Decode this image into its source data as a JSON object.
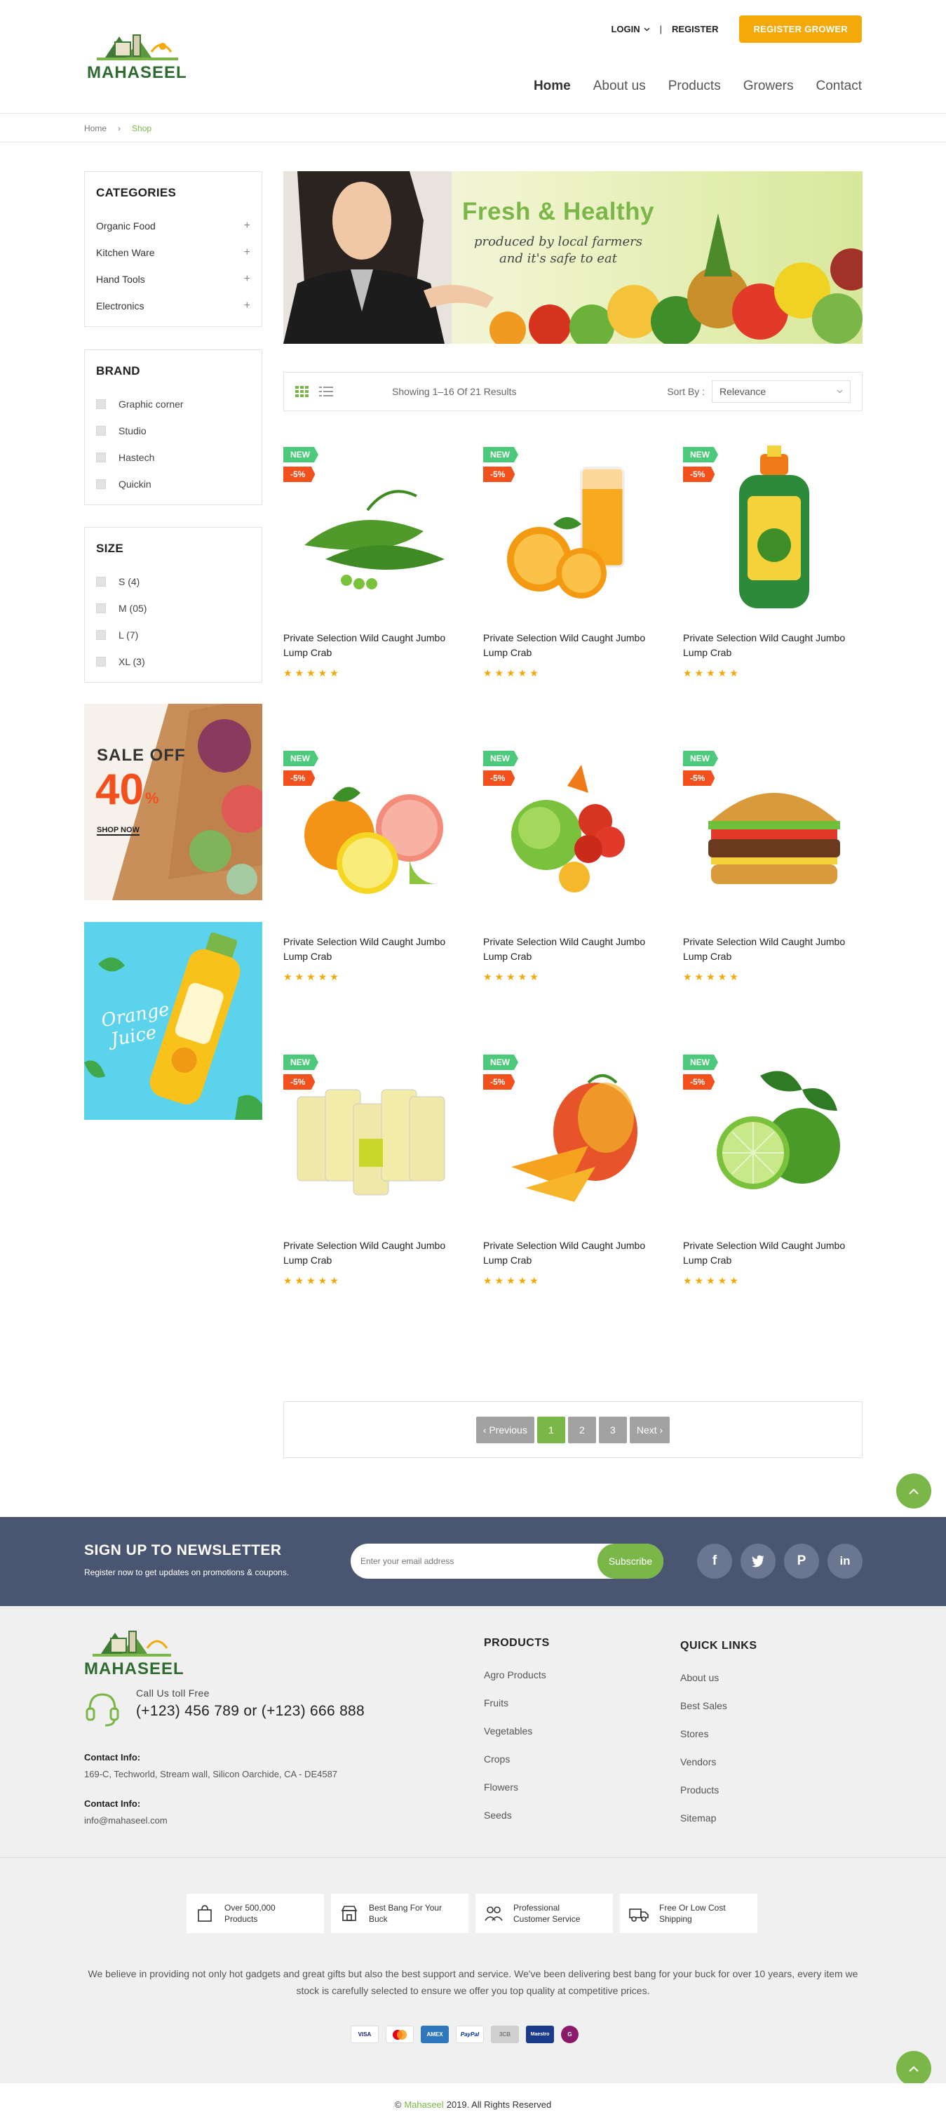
{
  "header": {
    "brand": "MAHASEEL",
    "login_label": "LOGIN",
    "separator": "|",
    "register_label": "REGISTER",
    "register_grower_label": "REGISTER GROWER",
    "nav": [
      {
        "label": "Home",
        "active": true
      },
      {
        "label": "About us"
      },
      {
        "label": "Products"
      },
      {
        "label": "Growers"
      },
      {
        "label": "Contact"
      }
    ]
  },
  "breadcrumb": {
    "home": "Home",
    "sep": "›",
    "current": "Shop"
  },
  "sidebar": {
    "categories_title": "CATEGORIES",
    "categories": [
      "Organic Food",
      "Kitchen Ware",
      "Hand Tools",
      "Electronics"
    ],
    "plus": "+",
    "brand_title": "BRAND",
    "brands": [
      "Graphic corner",
      "Studio",
      "Hastech",
      "Quickin"
    ],
    "size_title": "SIZE",
    "sizes": [
      "S (4)",
      "M (05)",
      "L (7)",
      "XL (3)"
    ],
    "promo_sale": {
      "line1": "SALE OFF",
      "percent": "40",
      "pct_sign": "%",
      "cta": "SHOP NOW"
    },
    "promo_juice": {
      "line1": "Orange",
      "line2": "Juice"
    }
  },
  "hero": {
    "title": "Fresh & Healthy",
    "line1": "produced by local farmers",
    "line2": "and it's safe to eat"
  },
  "toolbar": {
    "showing": "Showing 1–16 Of 21 Results",
    "sort_label": "Sort By :",
    "sort_value": "Relevance"
  },
  "products": {
    "badge_new": "NEW",
    "badge_sale": "-5%",
    "stars": "★★★★★",
    "items": [
      {
        "name": "Private Selection Wild Caught Jumbo Lump Crab",
        "image": "peas"
      },
      {
        "name": "Private Selection Wild Caught Jumbo Lump Crab",
        "image": "orange-juice"
      },
      {
        "name": "Private Selection Wild Caught Jumbo Lump Crab",
        "image": "fertilizer-bottle"
      },
      {
        "name": "Private Selection Wild Caught Jumbo Lump Crab",
        "image": "citrus"
      },
      {
        "name": "Private Selection Wild Caught Jumbo Lump Crab",
        "image": "vegetables"
      },
      {
        "name": "Private Selection Wild Caught Jumbo Lump Crab",
        "image": "burger"
      },
      {
        "name": "Private Selection Wild Caught Jumbo Lump Crab",
        "image": "seed-packs"
      },
      {
        "name": "Private Selection Wild Caught Jumbo Lump Crab",
        "image": "mango"
      },
      {
        "name": "Private Selection Wild Caught Jumbo Lump Crab",
        "image": "lime"
      }
    ]
  },
  "pagination": {
    "prev": "‹ Previous",
    "pages": [
      "1",
      "2",
      "3"
    ],
    "current": 1,
    "next": "Next ›"
  },
  "newsletter": {
    "title": "SIGN UP TO NEWSLETTER",
    "subtitle": "Register now to get updates on promotions & coupons.",
    "placeholder": "Enter your email address",
    "button": "Subscribe",
    "socials": [
      {
        "icon": "facebook-icon",
        "glyph": "f"
      },
      {
        "icon": "twitter-icon",
        "glyph": "t"
      },
      {
        "icon": "pinterest-icon",
        "glyph": "P"
      },
      {
        "icon": "linkedin-icon",
        "glyph": "in"
      }
    ]
  },
  "footer": {
    "brand": "MAHASEEL",
    "call_label": "Call Us toll Free",
    "phones": "(+123) 456 789 or (+123) 666 888",
    "contact1_label": "Contact Info:",
    "contact1_value": "169-C, Techworld, Stream wall, Silicon Oarchide, CA - DE4587",
    "contact2_label": "Contact Info:",
    "contact2_value": "info@mahaseel.com",
    "products_title": "PRODUCTS",
    "products_links": [
      "Agro Products",
      "Fruits",
      "Vegetables",
      "Crops",
      "Flowers",
      "Seeds"
    ],
    "quick_title": "QUICK LINKS",
    "quick_links": [
      "About us",
      "Best Sales",
      "Stores",
      "Vendors",
      "Products",
      "Sitemap"
    ],
    "features": [
      {
        "line1": "Over 500,000",
        "line2": "Products",
        "icon": "bag-icon"
      },
      {
        "line1": "Best Bang For Your",
        "line2": "Buck",
        "icon": "shop-icon"
      },
      {
        "line1": "Professional",
        "line2": "Customer Service",
        "icon": "people-icon"
      },
      {
        "line1": "Free Or Low Cost",
        "line2": "Shipping",
        "icon": "truck-icon"
      }
    ],
    "about_text": "We believe in providing not only hot gadgets and great gifts but also the best support and service. We've been delivering best bang for your buck for over 10 years, every item we stock is carefully selected to ensure we offer you top quality at competitive prices.",
    "payments": [
      {
        "label": "VISA",
        "color": "#ffffff",
        "text": "#1a1f71"
      },
      {
        "label": "MC",
        "color": "#ffffff",
        "text": "#eb001b"
      },
      {
        "label": "AMEX",
        "color": "#2e77bc",
        "text": "#ffffff"
      },
      {
        "label": "PayPal",
        "color": "#ffffff",
        "text": "#003087"
      },
      {
        "label": "3CB",
        "color": "#cfcfcf",
        "text": "#777777"
      },
      {
        "label": "Maestro",
        "color": "#1b3a8a",
        "text": "#ffffff"
      },
      {
        "label": "G",
        "color": "#8b1a6b",
        "text": "#ffffff"
      }
    ],
    "copyright_brand": "Mahaseel",
    "copyright_rest": "2019. All Rights Reserved",
    "copyright_symbol": "©"
  },
  "colors": {
    "accent": "#7ab648",
    "orange": "#f3a90a",
    "sale": "#f2511e",
    "new": "#4cc97a",
    "newsletter_bg": "#4a5671"
  }
}
